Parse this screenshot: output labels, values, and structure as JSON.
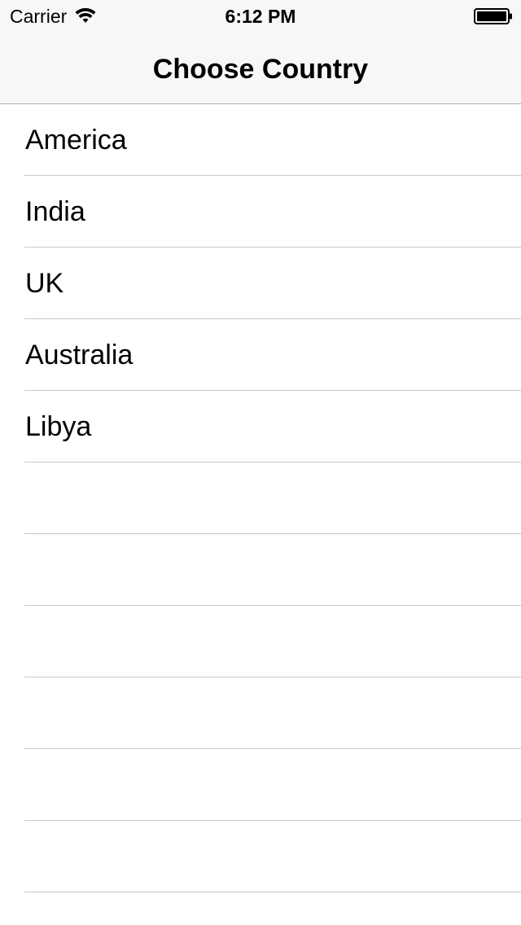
{
  "status_bar": {
    "carrier": "Carrier",
    "time": "6:12 PM",
    "wifi_icon": "wifi-icon",
    "battery_icon": "battery-icon"
  },
  "nav": {
    "title": "Choose Country"
  },
  "countries": {
    "items": [
      {
        "label": "America"
      },
      {
        "label": "India"
      },
      {
        "label": "UK"
      },
      {
        "label": "Australia"
      },
      {
        "label": "Libya"
      }
    ],
    "empty_row_count": 6
  },
  "colors": {
    "nav_background": "#f7f7f7",
    "separator": "#c8c7cc",
    "text": "#000000"
  }
}
